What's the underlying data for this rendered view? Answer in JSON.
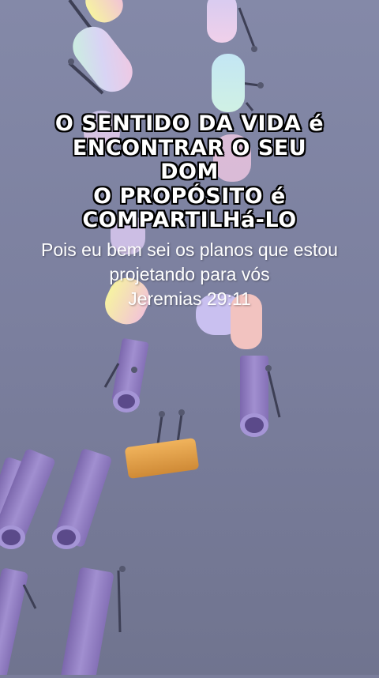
{
  "headline": {
    "line1": "O SENTIDO DA VIDA é",
    "line2": "ENCONTRAR O SEU",
    "line3": "DOM",
    "line4": "O PROPÓSITO é",
    "line5": "COMPARTILHá-LO"
  },
  "verse": {
    "line1": "Pois eu bem sei os planos que estou",
    "line2": "projetando para vós",
    "reference": "Jeremias 29:11"
  },
  "colors": {
    "background": "#7a7d9b",
    "pipe_purple": "#9b86c7",
    "pipe_orange": "#e4a24a",
    "pastel_yellow": "#f5f0a0",
    "pastel_mint": "#bff0d7",
    "pastel_pink": "#f4b8c8",
    "pastel_blue": "#b9dcf3"
  }
}
